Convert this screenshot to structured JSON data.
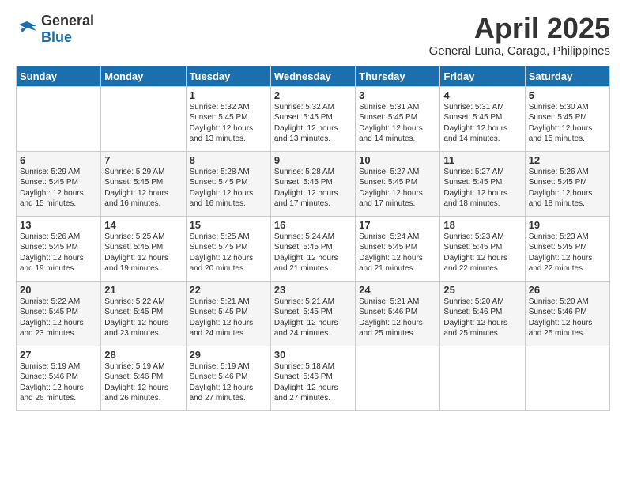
{
  "header": {
    "logo_general": "General",
    "logo_blue": "Blue",
    "title": "April 2025",
    "subtitle": "General Luna, Caraga, Philippines"
  },
  "days_of_week": [
    "Sunday",
    "Monday",
    "Tuesday",
    "Wednesday",
    "Thursday",
    "Friday",
    "Saturday"
  ],
  "weeks": [
    [
      {
        "day": "",
        "sunrise": "",
        "sunset": "",
        "daylight": ""
      },
      {
        "day": "",
        "sunrise": "",
        "sunset": "",
        "daylight": ""
      },
      {
        "day": "1",
        "sunrise": "Sunrise: 5:32 AM",
        "sunset": "Sunset: 5:45 PM",
        "daylight": "Daylight: 12 hours and 13 minutes."
      },
      {
        "day": "2",
        "sunrise": "Sunrise: 5:32 AM",
        "sunset": "Sunset: 5:45 PM",
        "daylight": "Daylight: 12 hours and 13 minutes."
      },
      {
        "day": "3",
        "sunrise": "Sunrise: 5:31 AM",
        "sunset": "Sunset: 5:45 PM",
        "daylight": "Daylight: 12 hours and 14 minutes."
      },
      {
        "day": "4",
        "sunrise": "Sunrise: 5:31 AM",
        "sunset": "Sunset: 5:45 PM",
        "daylight": "Daylight: 12 hours and 14 minutes."
      },
      {
        "day": "5",
        "sunrise": "Sunrise: 5:30 AM",
        "sunset": "Sunset: 5:45 PM",
        "daylight": "Daylight: 12 hours and 15 minutes."
      }
    ],
    [
      {
        "day": "6",
        "sunrise": "Sunrise: 5:29 AM",
        "sunset": "Sunset: 5:45 PM",
        "daylight": "Daylight: 12 hours and 15 minutes."
      },
      {
        "day": "7",
        "sunrise": "Sunrise: 5:29 AM",
        "sunset": "Sunset: 5:45 PM",
        "daylight": "Daylight: 12 hours and 16 minutes."
      },
      {
        "day": "8",
        "sunrise": "Sunrise: 5:28 AM",
        "sunset": "Sunset: 5:45 PM",
        "daylight": "Daylight: 12 hours and 16 minutes."
      },
      {
        "day": "9",
        "sunrise": "Sunrise: 5:28 AM",
        "sunset": "Sunset: 5:45 PM",
        "daylight": "Daylight: 12 hours and 17 minutes."
      },
      {
        "day": "10",
        "sunrise": "Sunrise: 5:27 AM",
        "sunset": "Sunset: 5:45 PM",
        "daylight": "Daylight: 12 hours and 17 minutes."
      },
      {
        "day": "11",
        "sunrise": "Sunrise: 5:27 AM",
        "sunset": "Sunset: 5:45 PM",
        "daylight": "Daylight: 12 hours and 18 minutes."
      },
      {
        "day": "12",
        "sunrise": "Sunrise: 5:26 AM",
        "sunset": "Sunset: 5:45 PM",
        "daylight": "Daylight: 12 hours and 18 minutes."
      }
    ],
    [
      {
        "day": "13",
        "sunrise": "Sunrise: 5:26 AM",
        "sunset": "Sunset: 5:45 PM",
        "daylight": "Daylight: 12 hours and 19 minutes."
      },
      {
        "day": "14",
        "sunrise": "Sunrise: 5:25 AM",
        "sunset": "Sunset: 5:45 PM",
        "daylight": "Daylight: 12 hours and 19 minutes."
      },
      {
        "day": "15",
        "sunrise": "Sunrise: 5:25 AM",
        "sunset": "Sunset: 5:45 PM",
        "daylight": "Daylight: 12 hours and 20 minutes."
      },
      {
        "day": "16",
        "sunrise": "Sunrise: 5:24 AM",
        "sunset": "Sunset: 5:45 PM",
        "daylight": "Daylight: 12 hours and 21 minutes."
      },
      {
        "day": "17",
        "sunrise": "Sunrise: 5:24 AM",
        "sunset": "Sunset: 5:45 PM",
        "daylight": "Daylight: 12 hours and 21 minutes."
      },
      {
        "day": "18",
        "sunrise": "Sunrise: 5:23 AM",
        "sunset": "Sunset: 5:45 PM",
        "daylight": "Daylight: 12 hours and 22 minutes."
      },
      {
        "day": "19",
        "sunrise": "Sunrise: 5:23 AM",
        "sunset": "Sunset: 5:45 PM",
        "daylight": "Daylight: 12 hours and 22 minutes."
      }
    ],
    [
      {
        "day": "20",
        "sunrise": "Sunrise: 5:22 AM",
        "sunset": "Sunset: 5:45 PM",
        "daylight": "Daylight: 12 hours and 23 minutes."
      },
      {
        "day": "21",
        "sunrise": "Sunrise: 5:22 AM",
        "sunset": "Sunset: 5:45 PM",
        "daylight": "Daylight: 12 hours and 23 minutes."
      },
      {
        "day": "22",
        "sunrise": "Sunrise: 5:21 AM",
        "sunset": "Sunset: 5:45 PM",
        "daylight": "Daylight: 12 hours and 24 minutes."
      },
      {
        "day": "23",
        "sunrise": "Sunrise: 5:21 AM",
        "sunset": "Sunset: 5:45 PM",
        "daylight": "Daylight: 12 hours and 24 minutes."
      },
      {
        "day": "24",
        "sunrise": "Sunrise: 5:21 AM",
        "sunset": "Sunset: 5:46 PM",
        "daylight": "Daylight: 12 hours and 25 minutes."
      },
      {
        "day": "25",
        "sunrise": "Sunrise: 5:20 AM",
        "sunset": "Sunset: 5:46 PM",
        "daylight": "Daylight: 12 hours and 25 minutes."
      },
      {
        "day": "26",
        "sunrise": "Sunrise: 5:20 AM",
        "sunset": "Sunset: 5:46 PM",
        "daylight": "Daylight: 12 hours and 25 minutes."
      }
    ],
    [
      {
        "day": "27",
        "sunrise": "Sunrise: 5:19 AM",
        "sunset": "Sunset: 5:46 PM",
        "daylight": "Daylight: 12 hours and 26 minutes."
      },
      {
        "day": "28",
        "sunrise": "Sunrise: 5:19 AM",
        "sunset": "Sunset: 5:46 PM",
        "daylight": "Daylight: 12 hours and 26 minutes."
      },
      {
        "day": "29",
        "sunrise": "Sunrise: 5:19 AM",
        "sunset": "Sunset: 5:46 PM",
        "daylight": "Daylight: 12 hours and 27 minutes."
      },
      {
        "day": "30",
        "sunrise": "Sunrise: 5:18 AM",
        "sunset": "Sunset: 5:46 PM",
        "daylight": "Daylight: 12 hours and 27 minutes."
      },
      {
        "day": "",
        "sunrise": "",
        "sunset": "",
        "daylight": ""
      },
      {
        "day": "",
        "sunrise": "",
        "sunset": "",
        "daylight": ""
      },
      {
        "day": "",
        "sunrise": "",
        "sunset": "",
        "daylight": ""
      }
    ]
  ]
}
